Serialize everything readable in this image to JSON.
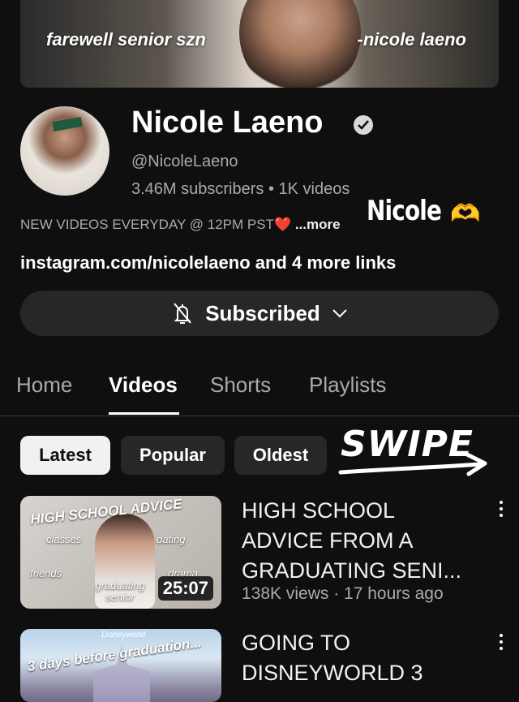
{
  "banner": {
    "left_text": "farewell senior szn",
    "right_text": "-nicole laeno"
  },
  "channel": {
    "name": "Nicole Laeno",
    "handle": "@NicoleLaeno",
    "stats": "3.46M subscribers • 1K videos",
    "description": "NEW VIDEOS EVERYDAY @ 12PM PST",
    "description_heart": "❤️",
    "more_label": " ...more",
    "links": "instagram.com/nicolelaeno and 4 more links"
  },
  "sticker": {
    "name": "Nicole",
    "hands": "🫶"
  },
  "subscribe": {
    "label": "Subscribed",
    "icon": "bell-off-icon"
  },
  "tabs": [
    "Home",
    "Videos",
    "Shorts",
    "Playlists"
  ],
  "active_tab": "Videos",
  "chips": [
    "Latest",
    "Popular",
    "Oldest"
  ],
  "active_chip": "Latest",
  "swipe_text": "SWIPE",
  "videos": [
    {
      "title_lines": [
        "HIGH SCHOOL",
        "ADVICE FROM A",
        "GRADUATING SENI..."
      ],
      "meta": "138K views · 17 hours ago",
      "duration": "25:07",
      "thumb_title": "HIGH SCHOOL ADVICE",
      "thumb_tags": [
        "classes",
        "dating",
        "friends",
        "drama",
        "graduating senior"
      ]
    },
    {
      "title_lines": [
        "GOING TO",
        "DISNEYWORLD 3"
      ],
      "thumb_brand": "Disneyworld",
      "thumb_title": "3 days before graduation..."
    }
  ],
  "colors": {
    "background": "#0f0f0f",
    "button_bg": "#272727",
    "text_primary": "#f1f1f1",
    "text_secondary": "#aaaaaa",
    "active_chip_bg": "#f1f1f1"
  }
}
